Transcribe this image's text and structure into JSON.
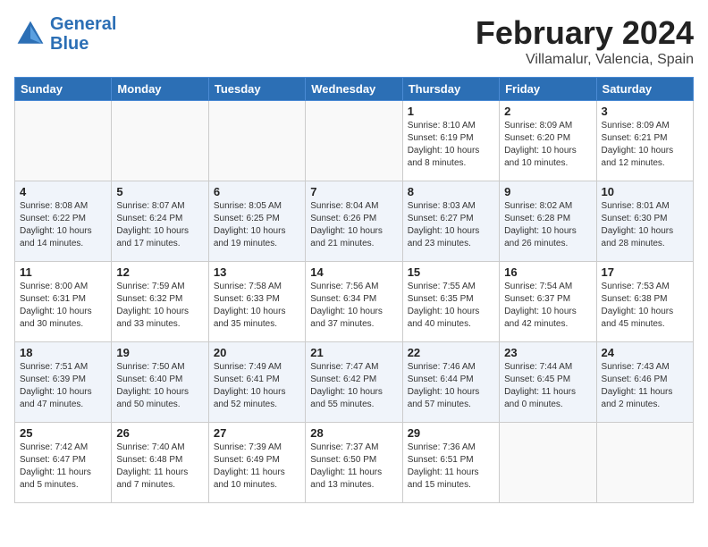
{
  "header": {
    "logo_line1": "General",
    "logo_line2": "Blue",
    "month": "February 2024",
    "location": "Villamalur, Valencia, Spain"
  },
  "weekdays": [
    "Sunday",
    "Monday",
    "Tuesday",
    "Wednesday",
    "Thursday",
    "Friday",
    "Saturday"
  ],
  "weeks": [
    [
      {
        "day": "",
        "info": ""
      },
      {
        "day": "",
        "info": ""
      },
      {
        "day": "",
        "info": ""
      },
      {
        "day": "",
        "info": ""
      },
      {
        "day": "1",
        "info": "Sunrise: 8:10 AM\nSunset: 6:19 PM\nDaylight: 10 hours\nand 8 minutes."
      },
      {
        "day": "2",
        "info": "Sunrise: 8:09 AM\nSunset: 6:20 PM\nDaylight: 10 hours\nand 10 minutes."
      },
      {
        "day": "3",
        "info": "Sunrise: 8:09 AM\nSunset: 6:21 PM\nDaylight: 10 hours\nand 12 minutes."
      }
    ],
    [
      {
        "day": "4",
        "info": "Sunrise: 8:08 AM\nSunset: 6:22 PM\nDaylight: 10 hours\nand 14 minutes."
      },
      {
        "day": "5",
        "info": "Sunrise: 8:07 AM\nSunset: 6:24 PM\nDaylight: 10 hours\nand 17 minutes."
      },
      {
        "day": "6",
        "info": "Sunrise: 8:05 AM\nSunset: 6:25 PM\nDaylight: 10 hours\nand 19 minutes."
      },
      {
        "day": "7",
        "info": "Sunrise: 8:04 AM\nSunset: 6:26 PM\nDaylight: 10 hours\nand 21 minutes."
      },
      {
        "day": "8",
        "info": "Sunrise: 8:03 AM\nSunset: 6:27 PM\nDaylight: 10 hours\nand 23 minutes."
      },
      {
        "day": "9",
        "info": "Sunrise: 8:02 AM\nSunset: 6:28 PM\nDaylight: 10 hours\nand 26 minutes."
      },
      {
        "day": "10",
        "info": "Sunrise: 8:01 AM\nSunset: 6:30 PM\nDaylight: 10 hours\nand 28 minutes."
      }
    ],
    [
      {
        "day": "11",
        "info": "Sunrise: 8:00 AM\nSunset: 6:31 PM\nDaylight: 10 hours\nand 30 minutes."
      },
      {
        "day": "12",
        "info": "Sunrise: 7:59 AM\nSunset: 6:32 PM\nDaylight: 10 hours\nand 33 minutes."
      },
      {
        "day": "13",
        "info": "Sunrise: 7:58 AM\nSunset: 6:33 PM\nDaylight: 10 hours\nand 35 minutes."
      },
      {
        "day": "14",
        "info": "Sunrise: 7:56 AM\nSunset: 6:34 PM\nDaylight: 10 hours\nand 37 minutes."
      },
      {
        "day": "15",
        "info": "Sunrise: 7:55 AM\nSunset: 6:35 PM\nDaylight: 10 hours\nand 40 minutes."
      },
      {
        "day": "16",
        "info": "Sunrise: 7:54 AM\nSunset: 6:37 PM\nDaylight: 10 hours\nand 42 minutes."
      },
      {
        "day": "17",
        "info": "Sunrise: 7:53 AM\nSunset: 6:38 PM\nDaylight: 10 hours\nand 45 minutes."
      }
    ],
    [
      {
        "day": "18",
        "info": "Sunrise: 7:51 AM\nSunset: 6:39 PM\nDaylight: 10 hours\nand 47 minutes."
      },
      {
        "day": "19",
        "info": "Sunrise: 7:50 AM\nSunset: 6:40 PM\nDaylight: 10 hours\nand 50 minutes."
      },
      {
        "day": "20",
        "info": "Sunrise: 7:49 AM\nSunset: 6:41 PM\nDaylight: 10 hours\nand 52 minutes."
      },
      {
        "day": "21",
        "info": "Sunrise: 7:47 AM\nSunset: 6:42 PM\nDaylight: 10 hours\nand 55 minutes."
      },
      {
        "day": "22",
        "info": "Sunrise: 7:46 AM\nSunset: 6:44 PM\nDaylight: 10 hours\nand 57 minutes."
      },
      {
        "day": "23",
        "info": "Sunrise: 7:44 AM\nSunset: 6:45 PM\nDaylight: 11 hours\nand 0 minutes."
      },
      {
        "day": "24",
        "info": "Sunrise: 7:43 AM\nSunset: 6:46 PM\nDaylight: 11 hours\nand 2 minutes."
      }
    ],
    [
      {
        "day": "25",
        "info": "Sunrise: 7:42 AM\nSunset: 6:47 PM\nDaylight: 11 hours\nand 5 minutes."
      },
      {
        "day": "26",
        "info": "Sunrise: 7:40 AM\nSunset: 6:48 PM\nDaylight: 11 hours\nand 7 minutes."
      },
      {
        "day": "27",
        "info": "Sunrise: 7:39 AM\nSunset: 6:49 PM\nDaylight: 11 hours\nand 10 minutes."
      },
      {
        "day": "28",
        "info": "Sunrise: 7:37 AM\nSunset: 6:50 PM\nDaylight: 11 hours\nand 13 minutes."
      },
      {
        "day": "29",
        "info": "Sunrise: 7:36 AM\nSunset: 6:51 PM\nDaylight: 11 hours\nand 15 minutes."
      },
      {
        "day": "",
        "info": ""
      },
      {
        "day": "",
        "info": ""
      }
    ]
  ]
}
